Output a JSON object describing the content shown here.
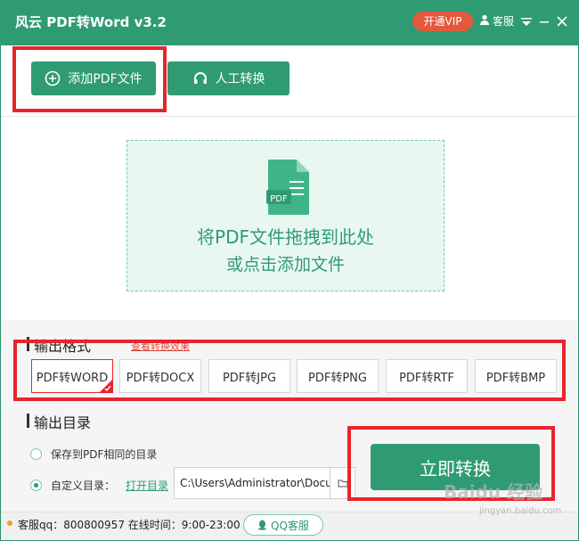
{
  "window": {
    "title": "风云 PDF转Word v3.2",
    "vip_label": "开通VIP",
    "service_label": "客服"
  },
  "toolbar": {
    "add_pdf_label": "添加PDF文件",
    "manual_convert_label": "人工转换"
  },
  "dropzone": {
    "file_icon_text": "PDF",
    "line1": "将PDF文件拖拽到此处",
    "line2": "或点击添加文件"
  },
  "output_format": {
    "title": "输出格式",
    "link_label": "查看转换效果",
    "selected": "PDF转WORD",
    "options": [
      "PDF转WORD",
      "PDF转DOCX",
      "PDF转JPG",
      "PDF转PNG",
      "PDF转RTF",
      "PDF转BMP"
    ]
  },
  "output_dir": {
    "title": "输出目录",
    "option_same": "保存到PDF相同的目录",
    "option_custom": "自定义目录：",
    "open_dir_label": "打开目录",
    "path_value": "C:\\Users\\Administrator\\Docu",
    "selected_option": "custom"
  },
  "convert_button": "立即转换",
  "status": {
    "text": "客服qq：800800957 在线时间：9:00-23:00",
    "qq_button": "QQ客服"
  },
  "watermark": {
    "text": "Baidu 经验",
    "sub": "jingyan.baidu.com"
  },
  "colors": {
    "brand_green": "#2f9b73",
    "vip_red": "#e4593c",
    "highlight_red": "#e8242c",
    "drop_bg": "#e9f7f1"
  }
}
